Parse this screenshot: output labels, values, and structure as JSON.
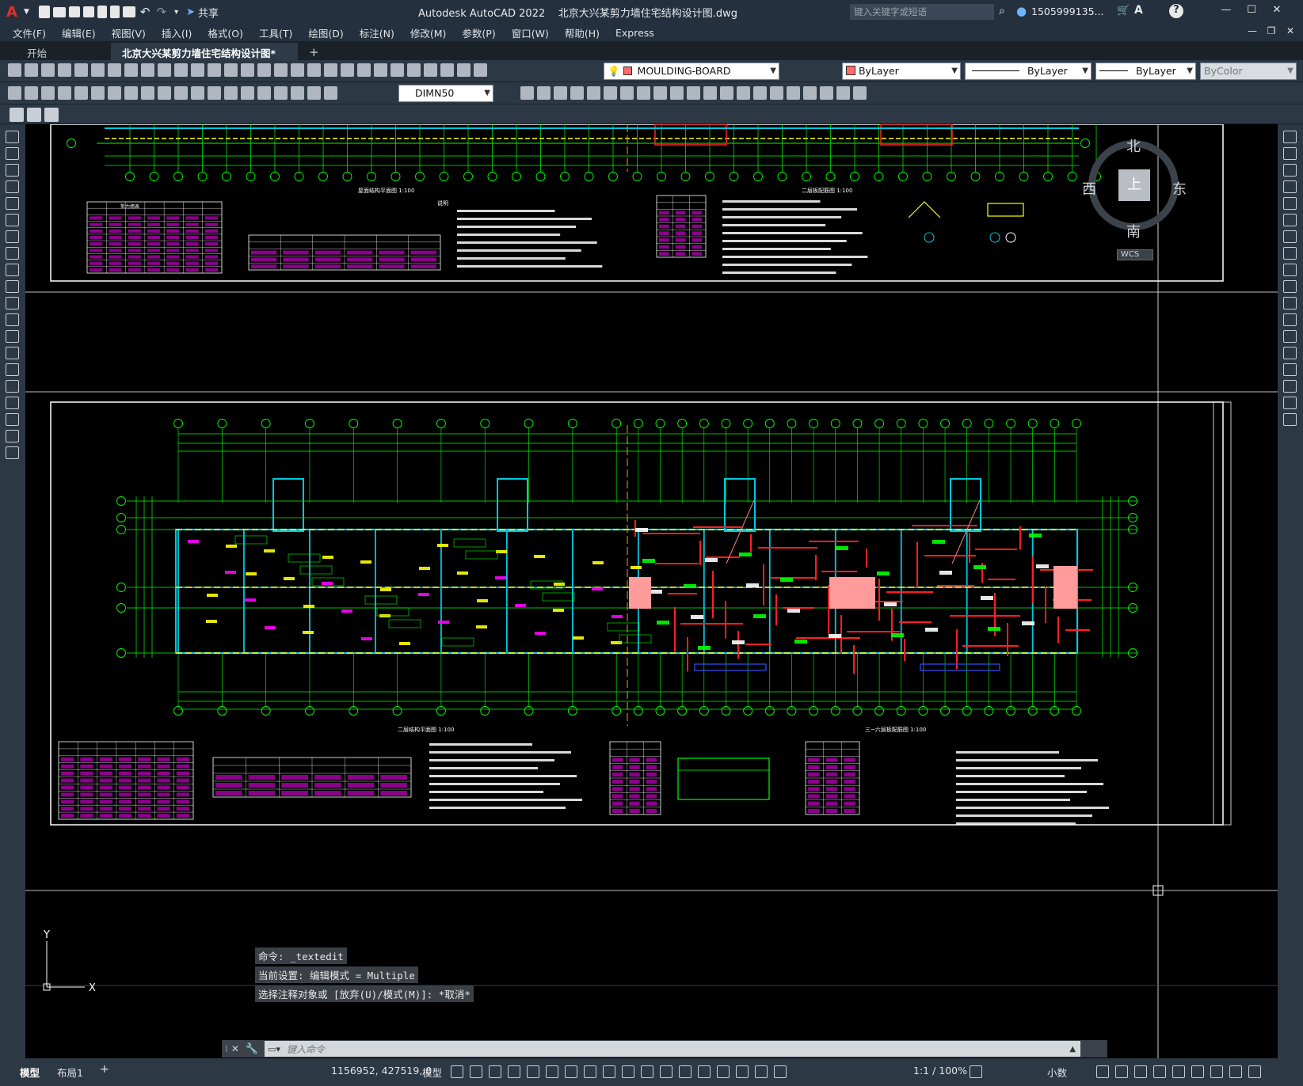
{
  "titlebar": {
    "logo": "A",
    "share": "共享",
    "title": "Autodesk AutoCAD 2022    北京大兴某剪力墙住宅结构设计图.dwg",
    "search_placeholder": "键入关键字或短语",
    "user": "1505999135...",
    "help": "?"
  },
  "menu": [
    "文件(F)",
    "编辑(E)",
    "视图(V)",
    "插入(I)",
    "格式(O)",
    "工具(T)",
    "绘图(D)",
    "标注(N)",
    "修改(M)",
    "参数(P)",
    "窗口(W)",
    "帮助(H)",
    "Express"
  ],
  "tabs": {
    "start": "开始",
    "doc": "北京大兴某剪力墙住宅结构设计图*",
    "add": "+"
  },
  "layer_combo": "MOULDING-BOARD",
  "color_combo": "ByLayer",
  "linetype_combo": "ByLayer",
  "lineweight_combo": "ByLayer",
  "plotstyle_combo": "ByColor",
  "dimstyle_combo": "DIMN50",
  "viewcube": {
    "north": "北",
    "south": "南",
    "east": "东",
    "west": "西",
    "top": "上",
    "wcs": "WCS"
  },
  "drawing": {
    "plan_upper_title": "屋面结构平面图 1:100",
    "plan_upper_title2": "二层板配筋图 1:100",
    "plan_lower_title": "二层结构平面图 1:100",
    "plan_lower_title2": "三~六层板配筋图 1:100",
    "table_title": "剪力墙表",
    "notes_title": "说明"
  },
  "command": {
    "history": [
      "命令: _textedit",
      "当前设置: 编辑模式 = Multiple",
      "选择注释对象或 [放弃(U)/模式(M)]: *取消*"
    ],
    "placeholder": "键入命令"
  },
  "ucs": {
    "x": "X",
    "y": "Y"
  },
  "status": {
    "model_tab": "模型",
    "layout_tab": "布局1",
    "add": "+",
    "coords": "1156952, 427519, 0",
    "space": "模型",
    "scale": "1:1 / 100%",
    "units": "小数"
  },
  "colors": {
    "accent": "#2b7cd3",
    "canvas": "#000000",
    "chrome": "#2d3845",
    "wall": "#00bcd4",
    "grid": "#00ff00"
  }
}
